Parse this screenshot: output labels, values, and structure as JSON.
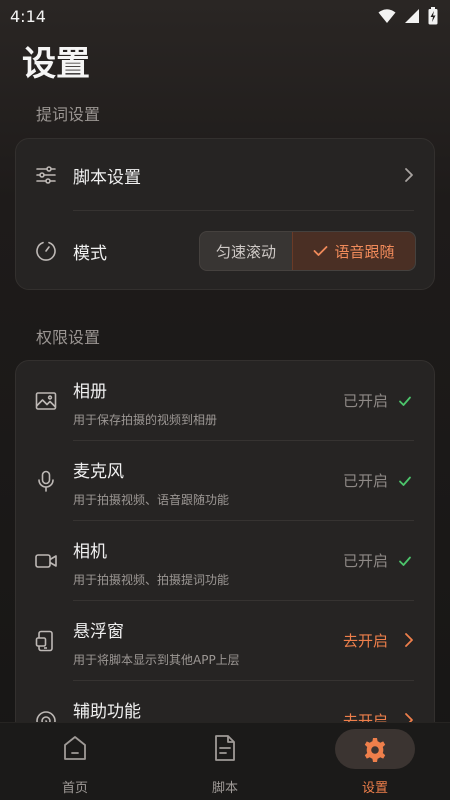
{
  "status_bar": {
    "time": "4:14"
  },
  "page_title": "设置",
  "prompt_section": {
    "label": "提词设置",
    "script_settings": "脚本设置",
    "mode_label": "模式",
    "mode_options": [
      "匀速滚动",
      "语音跟随"
    ],
    "mode_selected": "语音跟随"
  },
  "permission_section": {
    "label": "权限设置",
    "items": [
      {
        "title": "相册",
        "desc": "用于保存拍摄的视频到相册",
        "status": "已开启",
        "icon": "image-icon"
      },
      {
        "title": "麦克风",
        "desc": "用于拍摄视频、语音跟随功能",
        "status": "已开启",
        "icon": "mic-icon"
      },
      {
        "title": "相机",
        "desc": "用于拍摄视频、拍摄提词功能",
        "status": "已开启",
        "icon": "camera-icon"
      },
      {
        "title": "悬浮窗",
        "desc": "用于将脚本显示到其他APP上层",
        "status": "去开启",
        "icon": "floating-window-icon"
      },
      {
        "title": "辅助功能",
        "desc": "",
        "status": "去开启",
        "icon": "accessibility-icon"
      }
    ]
  },
  "bottom_nav": {
    "items": [
      {
        "label": "首页",
        "icon": "home-icon"
      },
      {
        "label": "脚本",
        "icon": "document-icon"
      },
      {
        "label": "设置",
        "icon": "gear-icon"
      }
    ],
    "active": "设置"
  },
  "colors": {
    "accent": "#ee7f4b",
    "enabled_check": "#4cc56b",
    "card": "#262423"
  }
}
